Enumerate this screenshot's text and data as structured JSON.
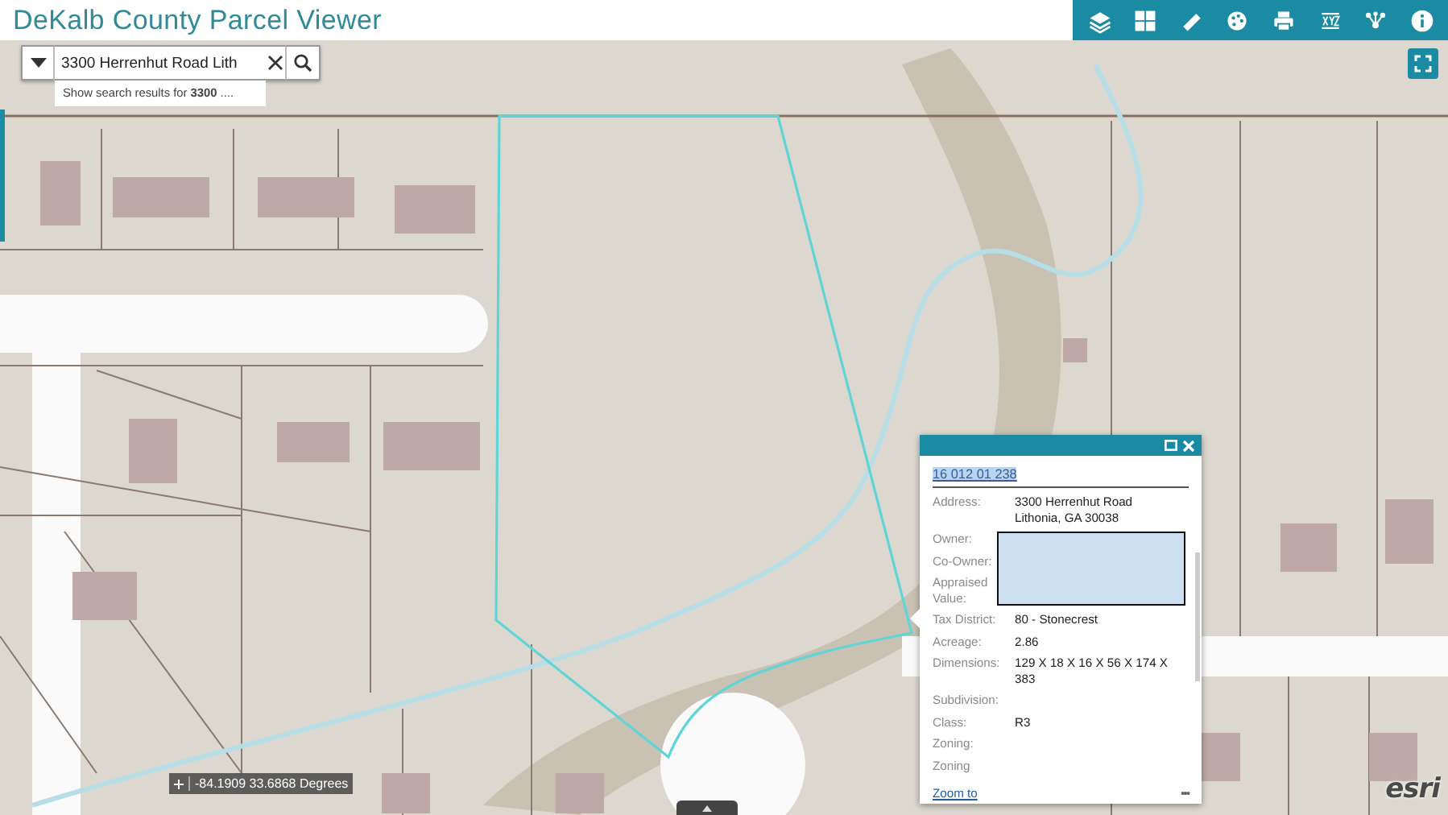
{
  "header": {
    "title": "DeKalb County Parcel Viewer"
  },
  "search": {
    "value": "3300 Herrenhut Road Lith",
    "suggestion": "Show search results for **3300** ...."
  },
  "coordinates": {
    "text": "-84.1909 33.6868 Degrees"
  },
  "popup": {
    "title": "16 012 01 238",
    "fields": [
      {
        "label": "Address:",
        "value": "3300 Herrenhut Road\nLithonia, GA 30038",
        "redacted": false
      },
      {
        "label": "Owner:",
        "redacted": true
      },
      {
        "label": "Co-Owner:",
        "redacted": true
      },
      {
        "label": "Appraised Value:",
        "redacted": true
      },
      {
        "label": "Tax District:",
        "value": "80 - Stonecrest",
        "redacted": false
      },
      {
        "label": "Acreage:",
        "value": "2.86",
        "redacted": false
      },
      {
        "label": "Dimensions:",
        "value": "129 X 18 X 16 X 56 X 174 X 383",
        "redacted": false
      },
      {
        "label": "Subdivision:",
        "redacted": false
      },
      {
        "label": "Class:",
        "value": "R3",
        "redacted": false
      },
      {
        "label": "Zoning:",
        "redacted": false
      },
      {
        "label": "Zoning",
        "redacted": false
      }
    ],
    "zoom_link": "Zoom to",
    "more": "•••"
  },
  "attribution": {
    "logo": "esri"
  }
}
